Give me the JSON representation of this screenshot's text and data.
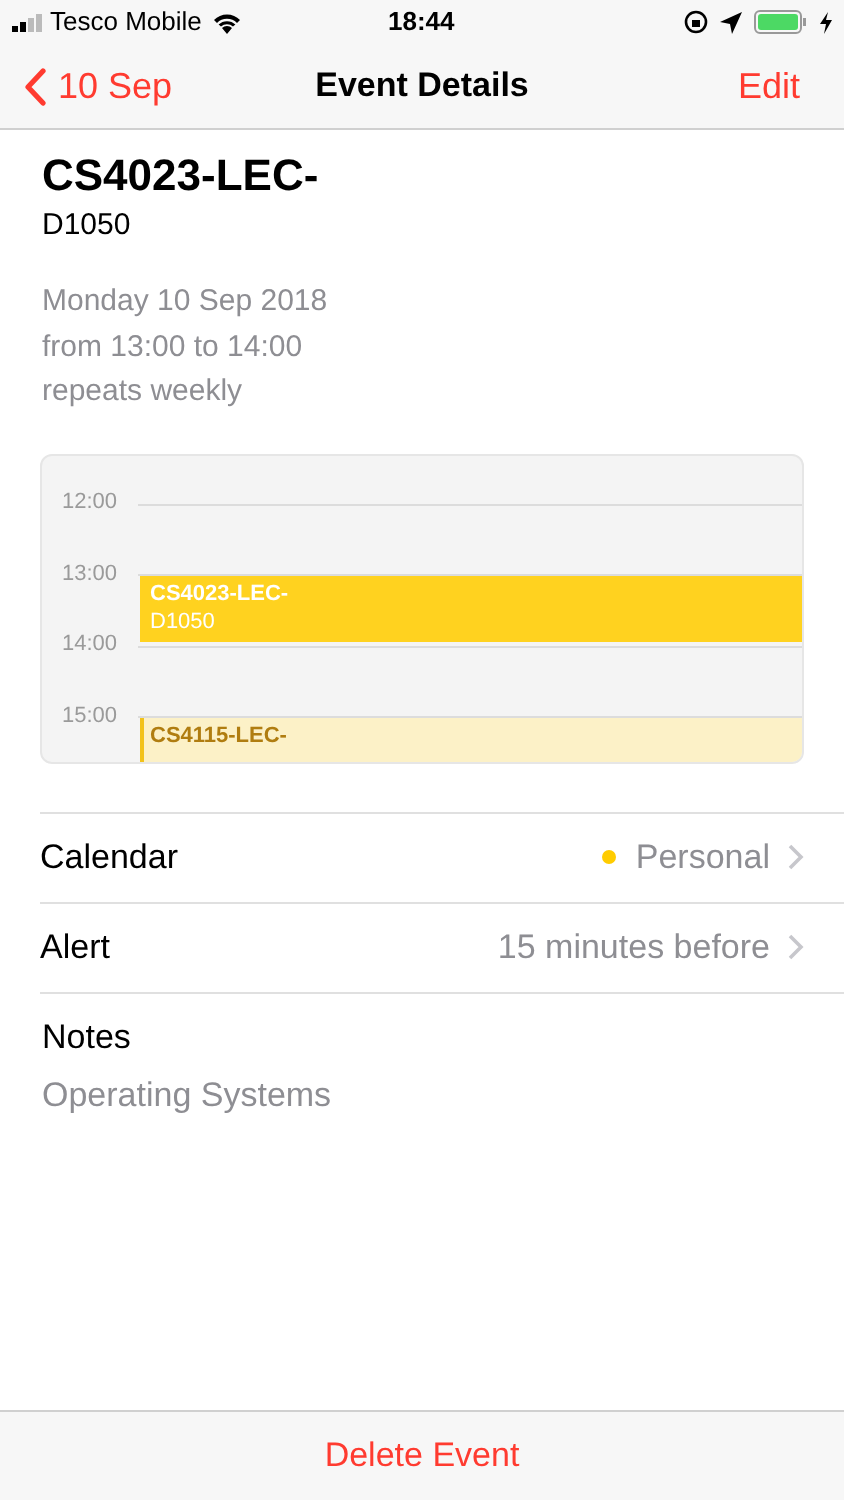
{
  "status_bar": {
    "carrier": "Tesco Mobile",
    "time": "18:44"
  },
  "nav": {
    "back": "10 Sep",
    "title": "Event Details",
    "action": "Edit"
  },
  "event": {
    "title": "CS4023-LEC-",
    "subtitle": "D1050",
    "date": "Monday 10 Sep 2018",
    "time_range": "from 13:00 to 14:00",
    "repeat": "repeats weekly"
  },
  "day_preview": {
    "hours": [
      "12:00",
      "13:00",
      "14:00",
      "15:00"
    ],
    "events": [
      {
        "title": "CS4023-LEC-",
        "subtitle": "D1050",
        "selected": true
      },
      {
        "title": "CS4115-LEC-",
        "selected": false
      }
    ]
  },
  "details": [
    {
      "label": "Calendar",
      "value": "Personal",
      "color": "#ffcc00"
    },
    {
      "label": "Alert",
      "value": "15 minutes before"
    }
  ],
  "notes": {
    "label": "Notes",
    "text": "Operating Systems"
  },
  "delete_button": "Delete Event"
}
